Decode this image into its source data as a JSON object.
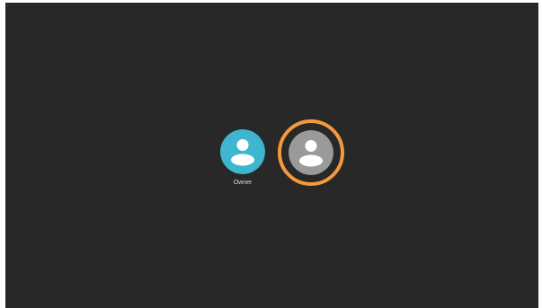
{
  "users": [
    {
      "label": "Owner",
      "icon": "person-icon",
      "color": "#3fb6cf",
      "selected": false
    },
    {
      "label": "",
      "icon": "person-icon",
      "color": "#9a9a9a",
      "selected": true,
      "highlight_color": "#f59a3c"
    }
  ],
  "colors": {
    "background": "#282828",
    "owner_avatar": "#3fb6cf",
    "guest_avatar": "#9a9a9a",
    "selection_ring": "#f59a3c",
    "label_text": "#dcdcdc"
  }
}
